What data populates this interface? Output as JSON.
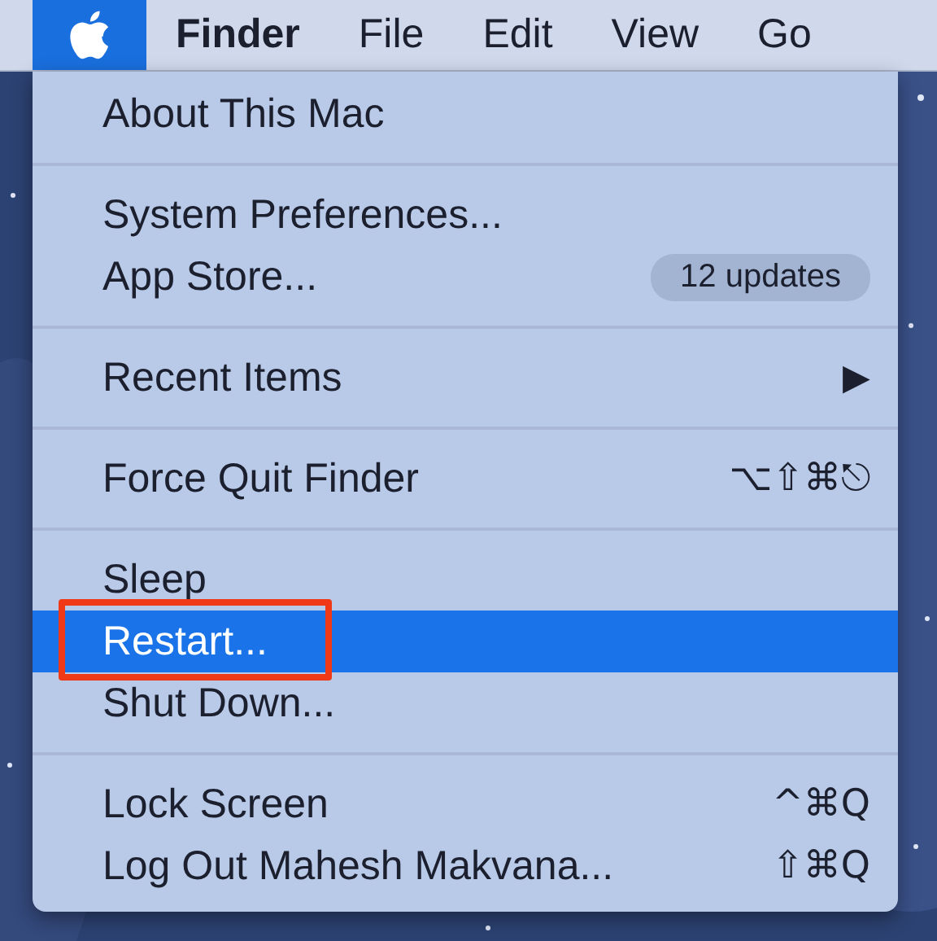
{
  "menu_bar": {
    "items": [
      {
        "kind": "apple",
        "selected": true
      },
      {
        "kind": "app",
        "label": "Finder",
        "selected": false
      },
      {
        "kind": "menu",
        "label": "File",
        "selected": false
      },
      {
        "kind": "menu",
        "label": "Edit",
        "selected": false
      },
      {
        "kind": "menu",
        "label": "View",
        "selected": false
      },
      {
        "kind": "menu",
        "label": "Go",
        "selected": false
      }
    ]
  },
  "apple_menu": {
    "groups": [
      [
        {
          "label": "About This Mac",
          "selected": false,
          "annotated": false
        }
      ],
      [
        {
          "label": "System Preferences...",
          "selected": false,
          "annotated": false
        },
        {
          "label": "App Store...",
          "badge": "12 updates",
          "selected": false,
          "annotated": false
        }
      ],
      [
        {
          "label": "Recent Items",
          "submenu": "▶",
          "selected": false,
          "annotated": false
        }
      ],
      [
        {
          "label": "Force Quit Finder",
          "shortcut": "⌥⇧⌘⎋",
          "selected": false,
          "annotated": false
        }
      ],
      [
        {
          "label": "Sleep",
          "selected": false,
          "annotated": false
        },
        {
          "label": "Restart...",
          "selected": true,
          "annotated": true
        },
        {
          "label": "Shut Down...",
          "selected": false,
          "annotated": false
        }
      ],
      [
        {
          "label": "Lock Screen",
          "shortcut": "^⌘Q",
          "selected": false,
          "annotated": false
        },
        {
          "label": "Log Out Mahesh Makvana...",
          "shortcut": "⇧⌘Q",
          "selected": false,
          "annotated": false
        }
      ]
    ]
  }
}
